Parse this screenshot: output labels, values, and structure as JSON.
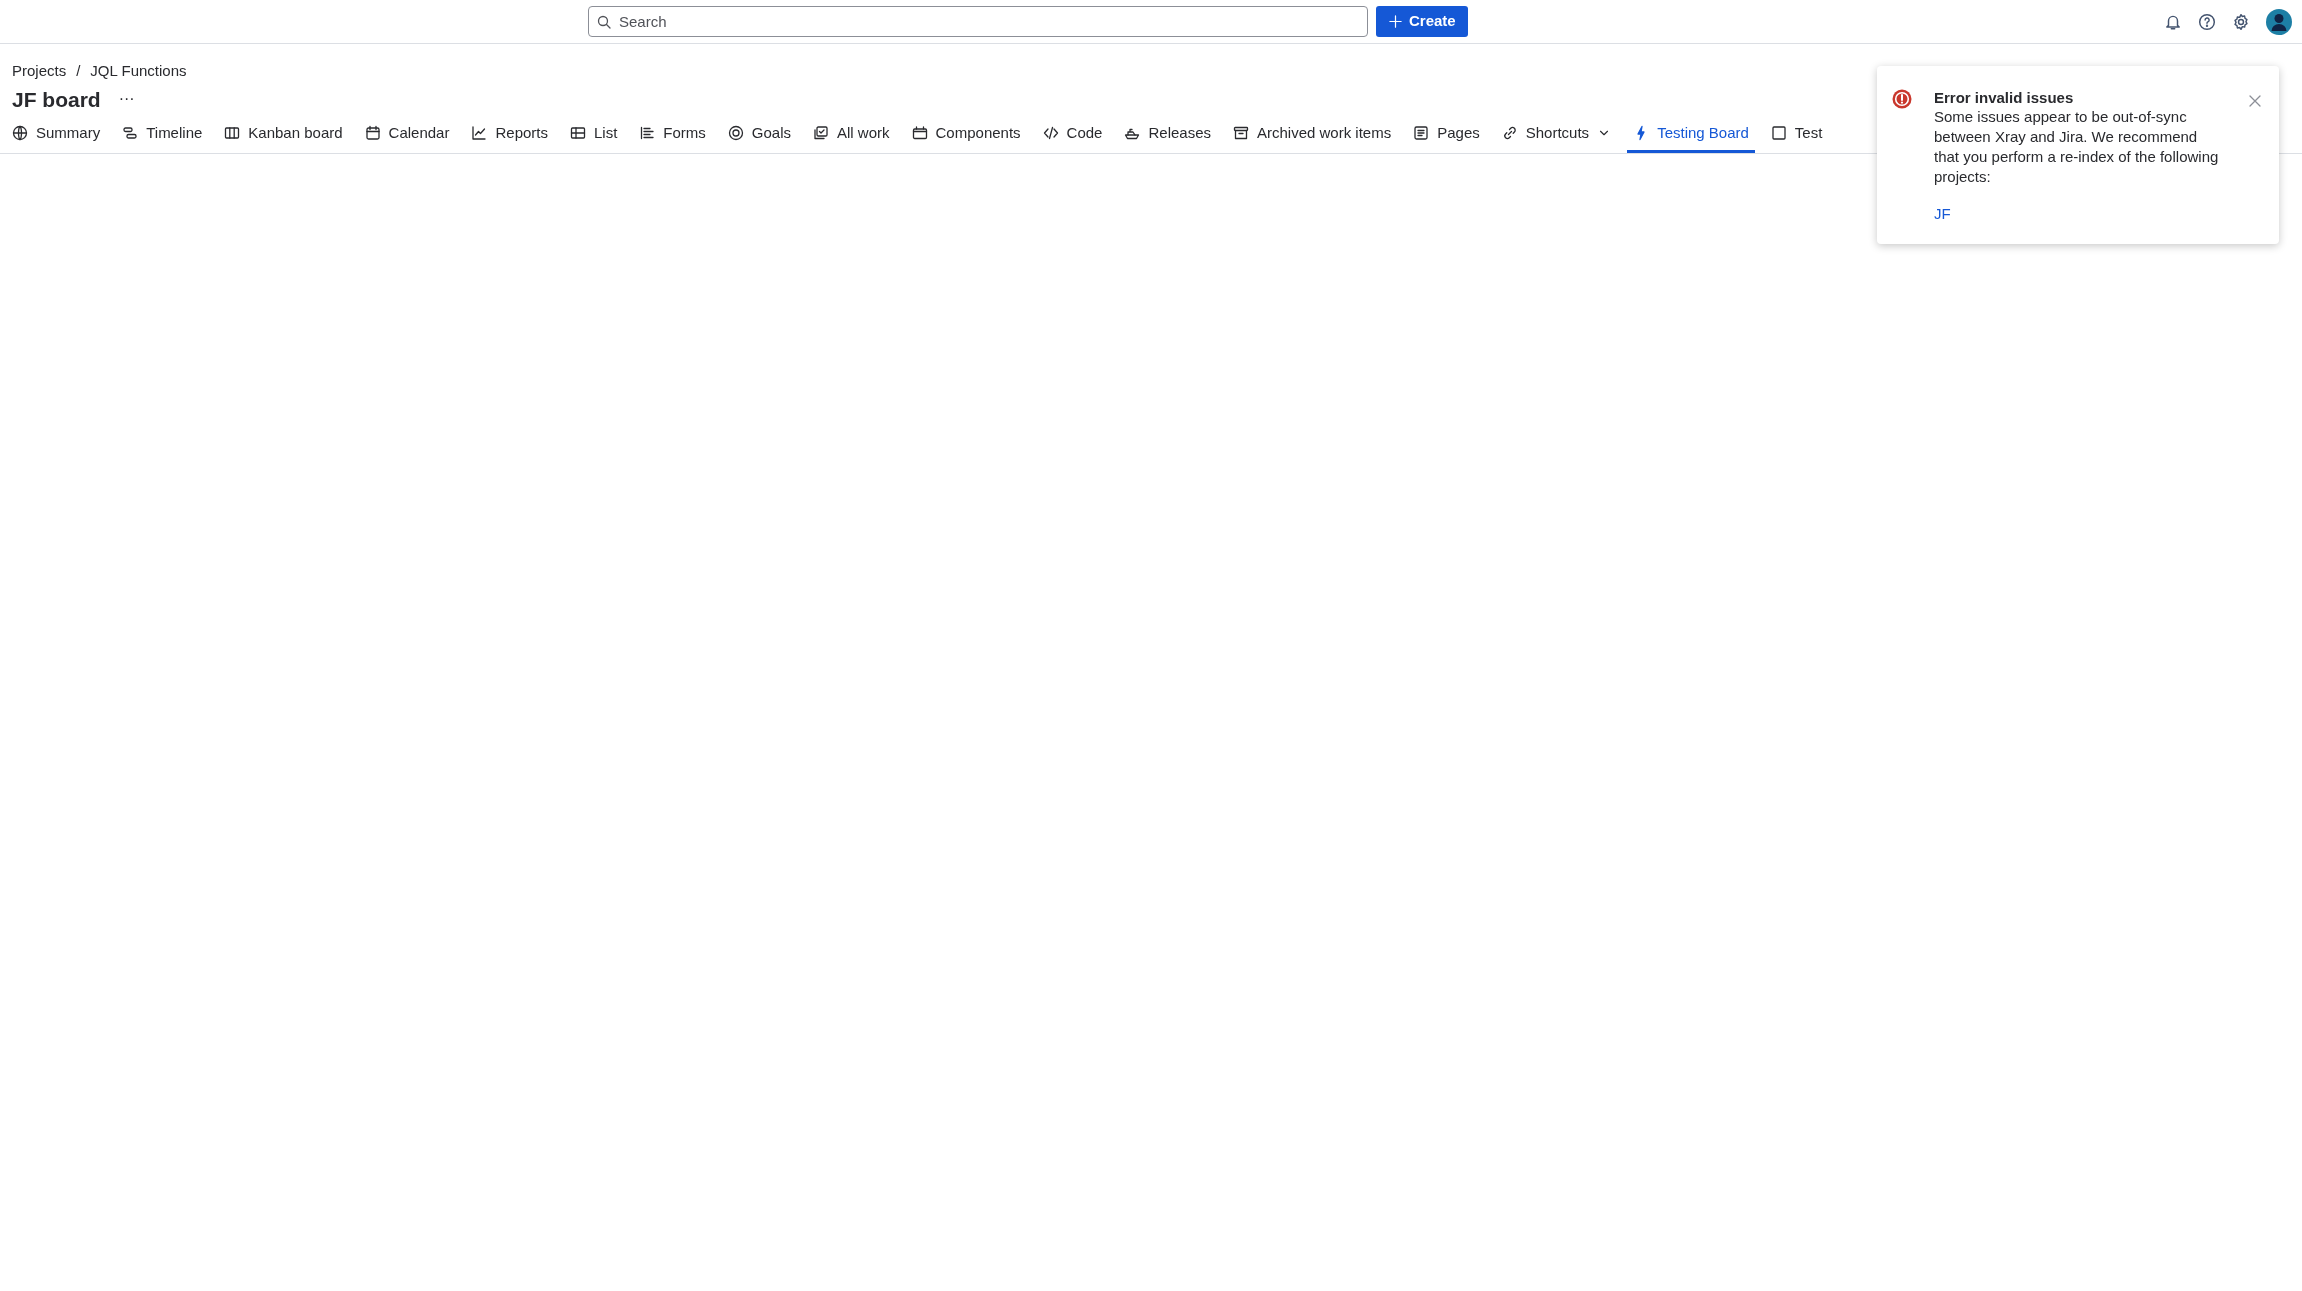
{
  "top_bar": {
    "search": {
      "placeholder": "Search"
    },
    "create_button": "Create"
  },
  "breadcrumbs": [
    "Projects",
    "JQL Functions"
  ],
  "breadcrumb_separator": "/",
  "title": "JF board",
  "more_button": "···",
  "tabs": [
    {
      "label": "Summary",
      "selected": false
    },
    {
      "label": "Timeline",
      "selected": false
    },
    {
      "label": "Kanban board",
      "selected": false
    },
    {
      "label": "Calendar",
      "selected": false
    },
    {
      "label": "Reports",
      "selected": false
    },
    {
      "label": "List",
      "selected": false
    },
    {
      "label": "Forms",
      "selected": false
    },
    {
      "label": "Goals",
      "selected": false
    },
    {
      "label": "All work",
      "selected": false
    },
    {
      "label": "Components",
      "selected": false
    },
    {
      "label": "Code",
      "selected": false
    },
    {
      "label": "Releases",
      "selected": false
    },
    {
      "label": "Archived work items",
      "selected": false
    },
    {
      "label": "Pages",
      "selected": false
    },
    {
      "label": "Shortcuts",
      "selected": false,
      "dropdown": true
    },
    {
      "label": "Testing Board",
      "selected": true
    },
    {
      "label": "Test",
      "selected": false
    }
  ],
  "notification": {
    "title": "Error invalid issues",
    "message": "Some issues appear to be out-of-sync between Xray and Jira. We recommend that you perform a re-index of the following projects:",
    "link": "JF"
  }
}
